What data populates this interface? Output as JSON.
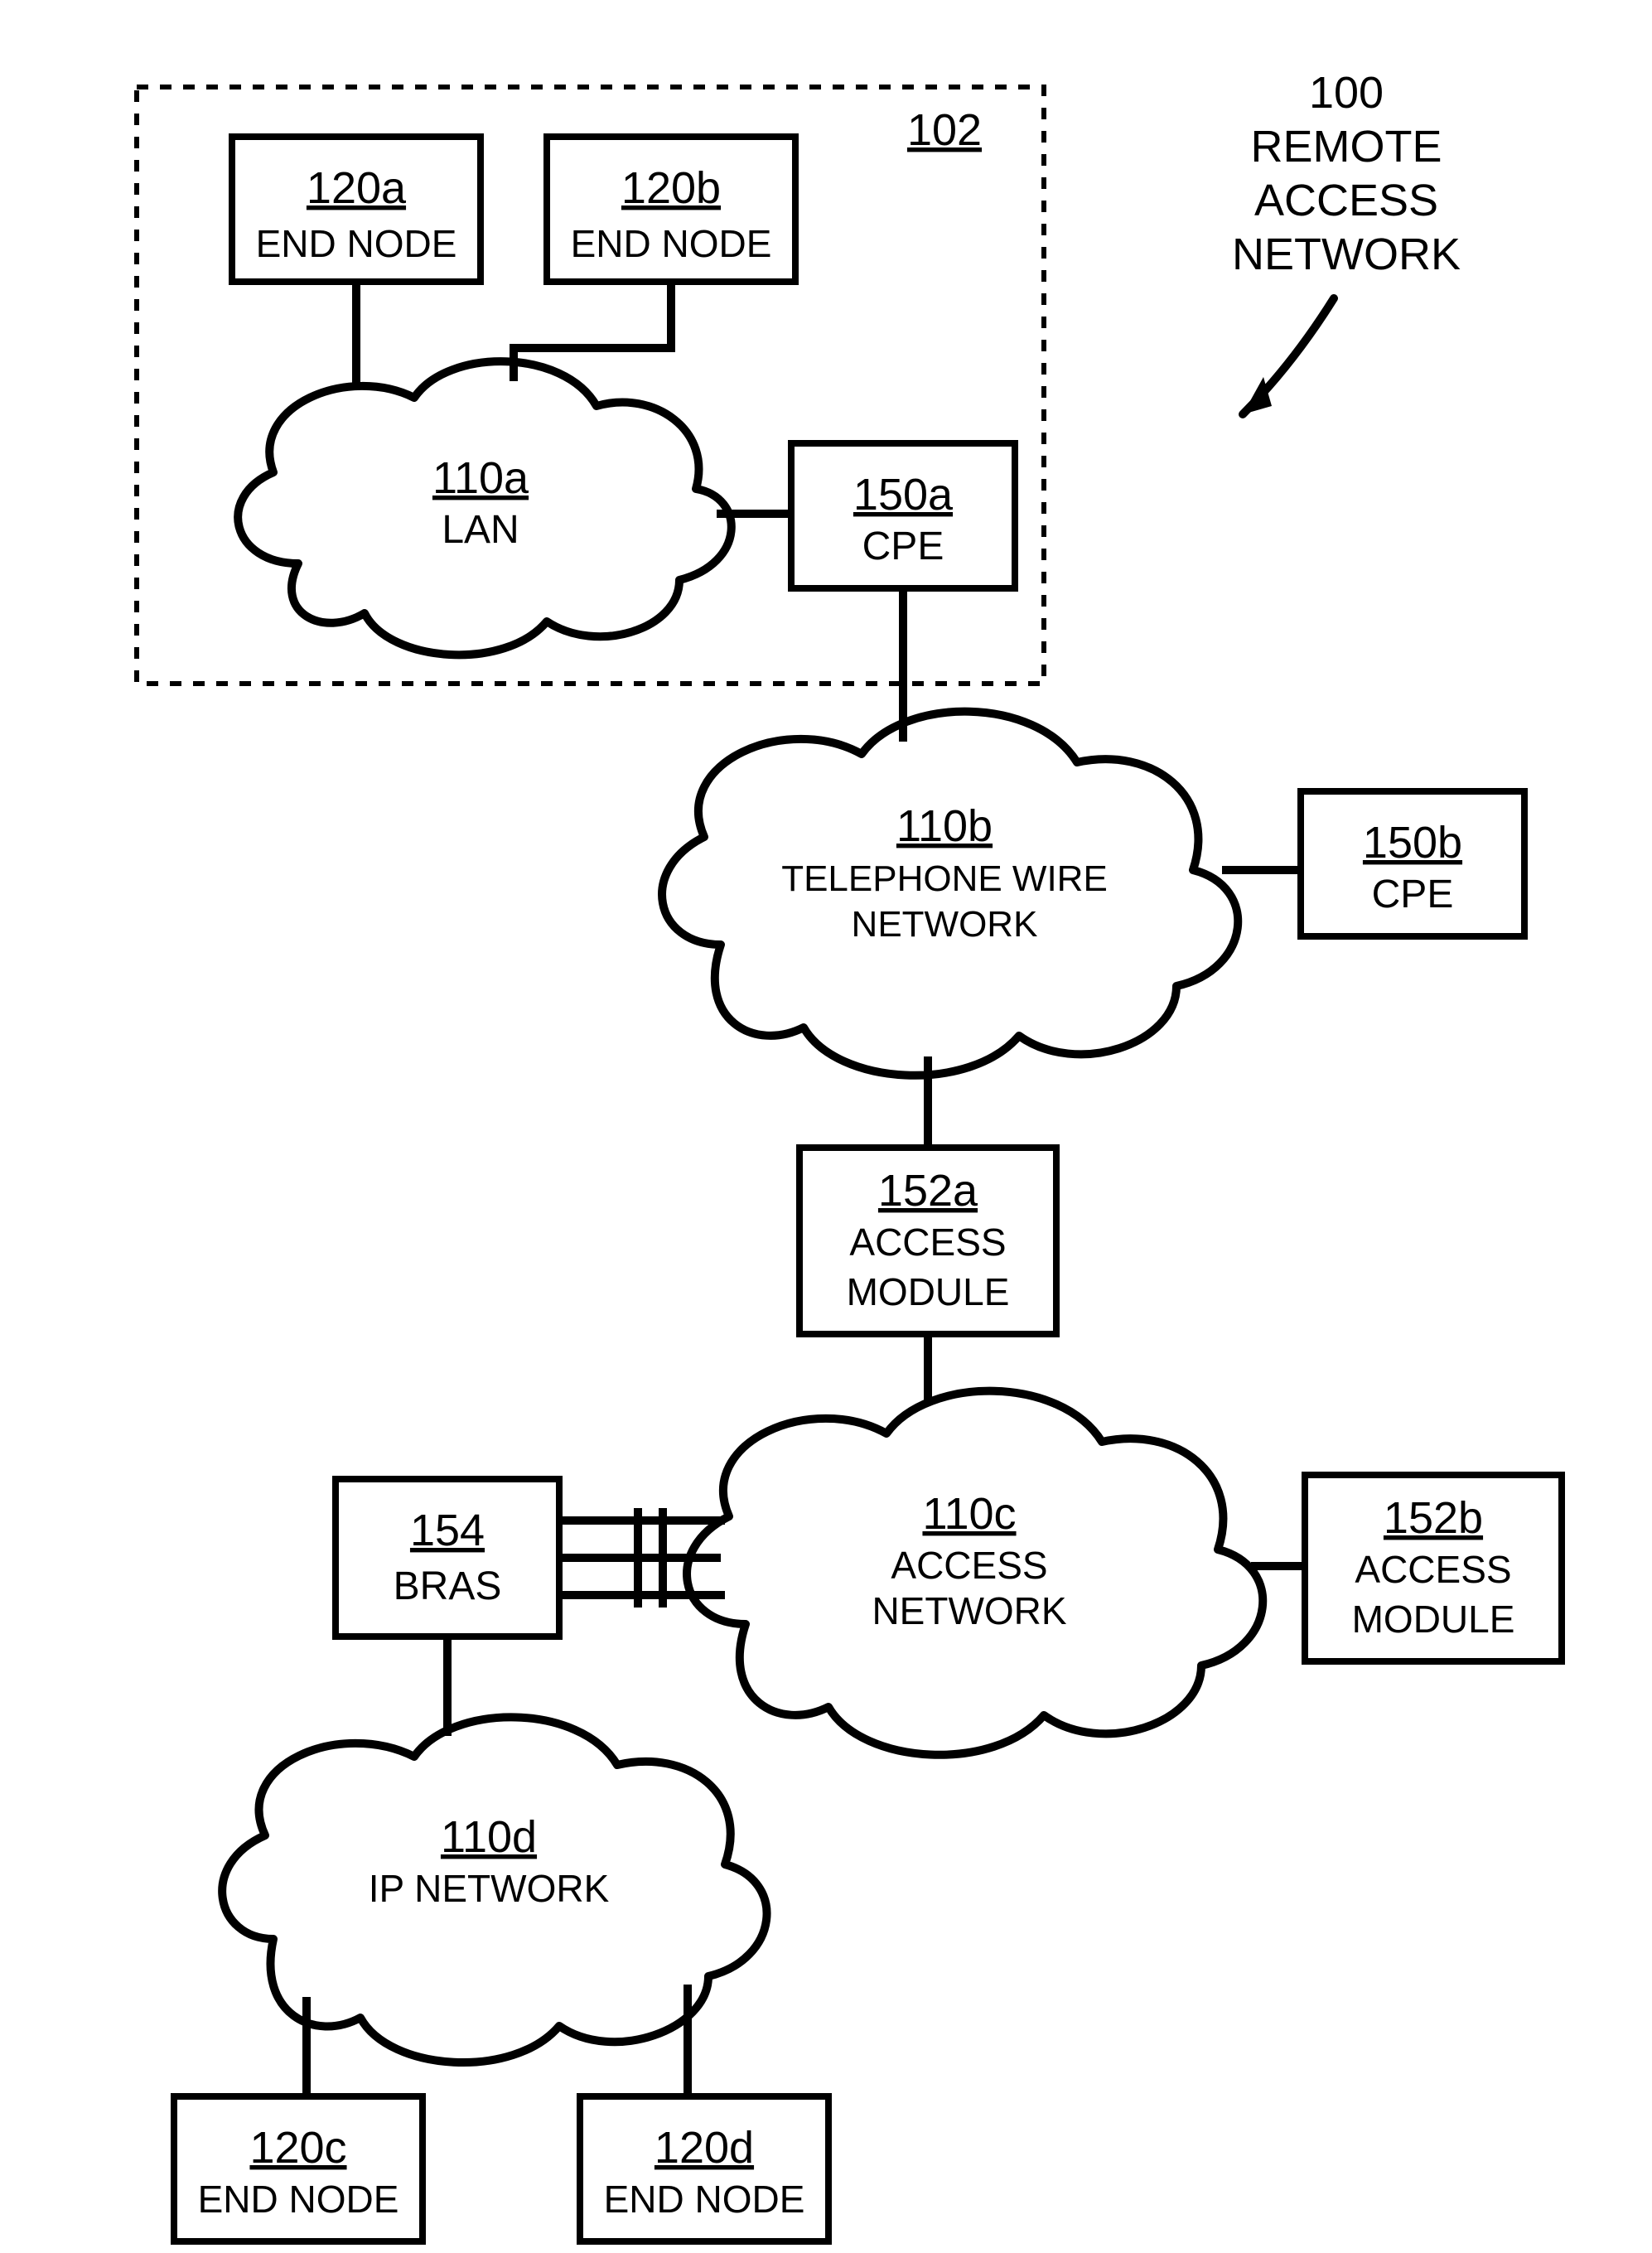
{
  "title": {
    "ref": "100",
    "line1": "REMOTE",
    "line2": "ACCESS",
    "line3": "NETWORK"
  },
  "premises": {
    "ref": "102"
  },
  "node120a": {
    "ref": "120a",
    "label": "END NODE"
  },
  "node120b": {
    "ref": "120b",
    "label": "END NODE"
  },
  "node120c": {
    "ref": "120c",
    "label": "END NODE"
  },
  "node120d": {
    "ref": "120d",
    "label": "END NODE"
  },
  "cloud110a": {
    "ref": "110a",
    "label": "LAN"
  },
  "cloud110b": {
    "ref": "110b",
    "line1": "TELEPHONE WIRE",
    "line2": "NETWORK"
  },
  "cloud110c": {
    "ref": "110c",
    "line1": "ACCESS",
    "line2": "NETWORK"
  },
  "cloud110d": {
    "ref": "110d",
    "label": "IP NETWORK"
  },
  "node150a": {
    "ref": "150a",
    "label": "CPE"
  },
  "node150b": {
    "ref": "150b",
    "label": "CPE"
  },
  "node152a": {
    "ref": "152a",
    "line1": "ACCESS",
    "line2": "MODULE"
  },
  "node152b": {
    "ref": "152b",
    "line1": "ACCESS",
    "line2": "MODULE"
  },
  "node154": {
    "ref": "154",
    "label": "BRAS"
  }
}
